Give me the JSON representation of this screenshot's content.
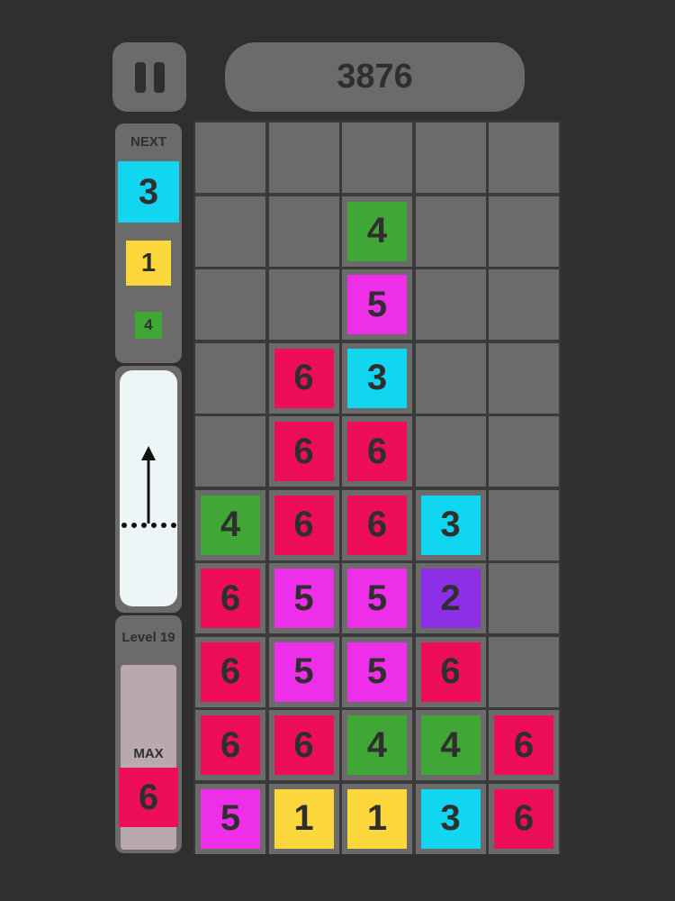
{
  "score": "3876",
  "next": {
    "label": "NEXT",
    "tiles": [
      "3",
      "1",
      "4"
    ]
  },
  "level": {
    "label": "Level 19",
    "max_label": "MAX",
    "max_value": "6"
  },
  "colors": {
    "1": "#fdd83d",
    "2": "#8c2fe6",
    "3": "#12d6ef",
    "4": "#40a636",
    "5": "#ee2fe9",
    "6": "#ee0e57",
    "cell": "#6b6b6b",
    "background": "#2f2f2f"
  },
  "board": {
    "columns": 5,
    "rows": 10,
    "grid": [
      [
        "",
        "",
        "",
        "",
        ""
      ],
      [
        "",
        "",
        "4",
        "",
        ""
      ],
      [
        "",
        "",
        "5",
        "",
        ""
      ],
      [
        "",
        "6",
        "3",
        "",
        ""
      ],
      [
        "",
        "6",
        "6",
        "",
        ""
      ],
      [
        "4",
        "6",
        "6",
        "3",
        ""
      ],
      [
        "6",
        "5",
        "5",
        "2",
        ""
      ],
      [
        "6",
        "5",
        "5",
        "6",
        ""
      ],
      [
        "6",
        "6",
        "4",
        "4",
        "6"
      ],
      [
        "5",
        "1",
        "1",
        "3",
        "6"
      ]
    ]
  }
}
